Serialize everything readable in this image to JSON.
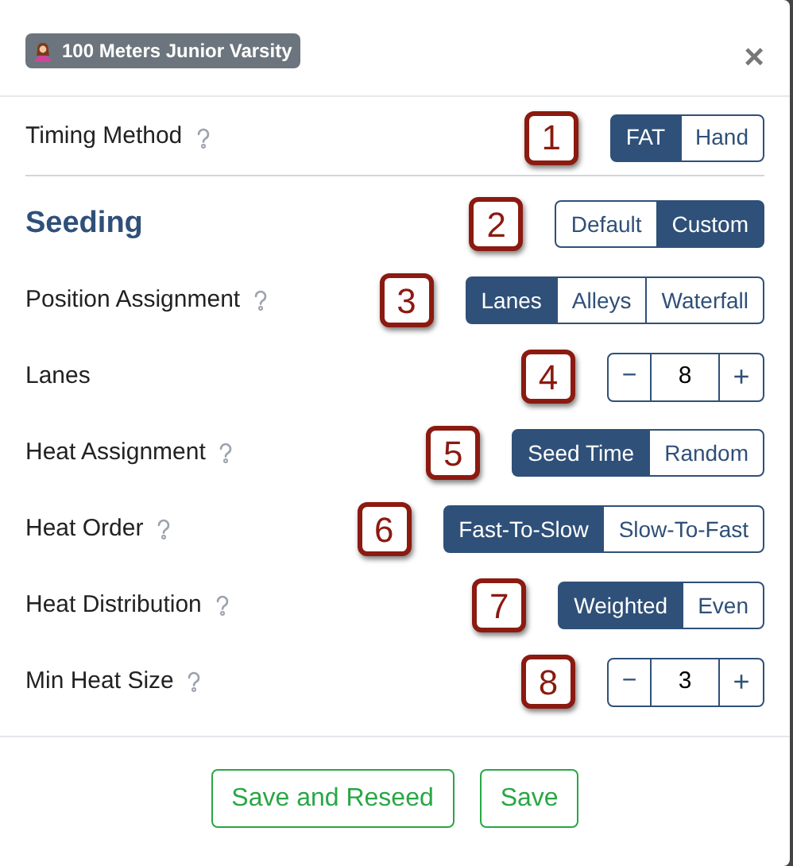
{
  "header": {
    "badge": "100 Meters Junior Varsity",
    "close": "×"
  },
  "rows": [
    {
      "kind": "segmented",
      "label": "Timing Method",
      "help": true,
      "callout": "1",
      "options": [
        {
          "label": "FAT",
          "selected": true
        },
        {
          "label": "Hand",
          "selected": false
        }
      ]
    },
    {
      "kind": "heading",
      "label": "Seeding",
      "help": false,
      "callout": "2",
      "options": [
        {
          "label": "Default",
          "selected": false
        },
        {
          "label": "Custom",
          "selected": true
        }
      ]
    },
    {
      "kind": "segmented",
      "label": "Position Assignment",
      "help": true,
      "callout": "3",
      "options": [
        {
          "label": "Lanes",
          "selected": true
        },
        {
          "label": "Alleys",
          "selected": false
        },
        {
          "label": "Waterfall",
          "selected": false
        }
      ]
    },
    {
      "kind": "stepper",
      "label": "Lanes",
      "help": false,
      "callout": "4",
      "minus": "−",
      "value": "8",
      "plus": "+"
    },
    {
      "kind": "segmented",
      "label": "Heat Assignment",
      "help": true,
      "callout": "5",
      "options": [
        {
          "label": "Seed Time",
          "selected": true
        },
        {
          "label": "Random",
          "selected": false
        }
      ]
    },
    {
      "kind": "segmented",
      "label": "Heat Order",
      "help": true,
      "callout": "6",
      "options": [
        {
          "label": "Fast-To-Slow",
          "selected": true
        },
        {
          "label": "Slow-To-Fast",
          "selected": false
        }
      ]
    },
    {
      "kind": "segmented",
      "label": "Heat Distribution",
      "help": true,
      "callout": "7",
      "options": [
        {
          "label": "Weighted",
          "selected": true
        },
        {
          "label": "Even",
          "selected": false
        }
      ]
    },
    {
      "kind": "stepper",
      "label": "Min Heat Size",
      "help": true,
      "callout": "8",
      "minus": "−",
      "value": "3",
      "plus": "+"
    }
  ],
  "footer": {
    "buttons": [
      "Save and Reseed",
      "Save"
    ]
  }
}
